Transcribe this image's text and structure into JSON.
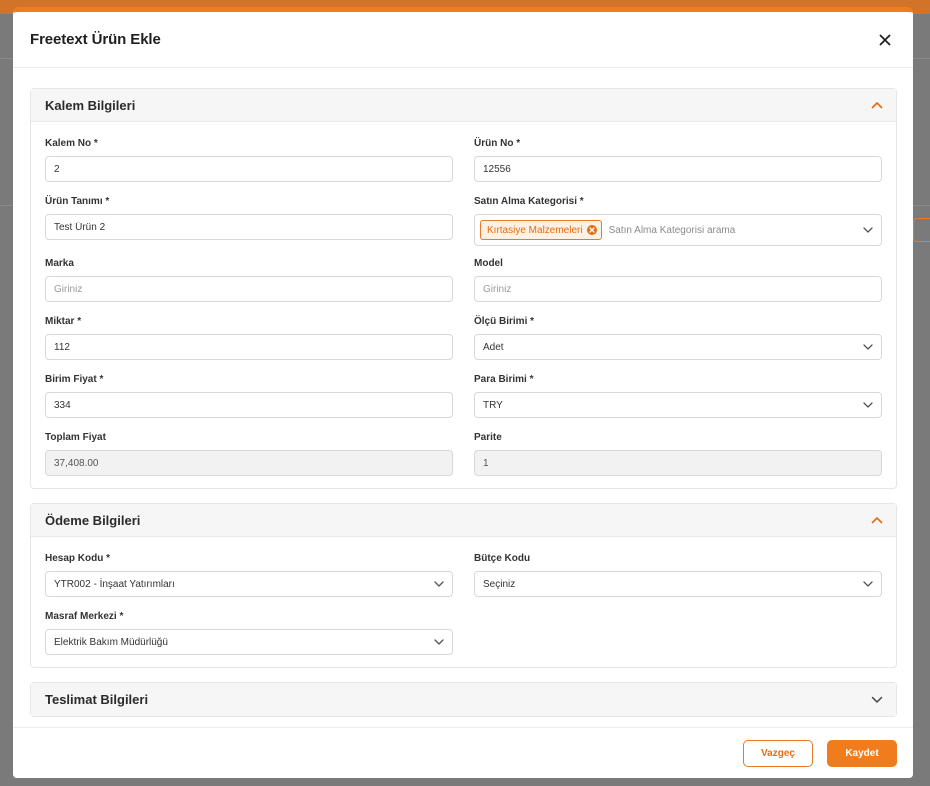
{
  "modal": {
    "title": "Freetext Ürün Ekle"
  },
  "sections": {
    "kalem": {
      "title": "Kalem Bilgileri",
      "kalem_no": {
        "label": "Kalem No *",
        "value": "2"
      },
      "urun_no": {
        "label": "Ürün No *",
        "value": "12556"
      },
      "urun_tanimi": {
        "label": "Ürün Tanımı *",
        "value": "Test Ürün 2"
      },
      "satin_alma_kategorisi": {
        "label": "Satın Alma Kategorisi *",
        "tag": "Kırtasiye Malzemeleri",
        "placeholder": "Satın Alma Kategorisi arama"
      },
      "marka": {
        "label": "Marka",
        "placeholder": "Giriniz"
      },
      "model": {
        "label": "Model",
        "placeholder": "Giriniz"
      },
      "miktar": {
        "label": "Miktar *",
        "value": "112"
      },
      "olcu_birimi": {
        "label": "Ölçü Birimi *",
        "value": "Adet"
      },
      "birim_fiyat": {
        "label": "Birim Fiyat *",
        "value": "334"
      },
      "para_birimi": {
        "label": "Para Birimi *",
        "value": "TRY"
      },
      "toplam_fiyat": {
        "label": "Toplam Fiyat",
        "value": "37,408.00"
      },
      "parite": {
        "label": "Parite",
        "value": "1"
      }
    },
    "odeme": {
      "title": "Ödeme Bilgileri",
      "hesap_kodu": {
        "label": "Hesap Kodu *",
        "value": "YTR002 - İnşaat Yatırımları"
      },
      "butce_kodu": {
        "label": "Bütçe Kodu",
        "value": "Seçiniz"
      },
      "masraf_merkezi": {
        "label": "Masraf Merkezi *",
        "value": "Elektrik Bakım Müdürlüğü"
      }
    },
    "teslimat": {
      "title": "Teslimat Bilgileri"
    }
  },
  "footer": {
    "cancel_label": "Vazgeç",
    "save_label": "Kaydet"
  },
  "colors": {
    "accent": "#f07c1c",
    "accent_text": "#e46d12"
  },
  "icons": {
    "close": "close-icon",
    "collapse": "chevron-up-icon",
    "expand": "chevron-down-icon"
  }
}
